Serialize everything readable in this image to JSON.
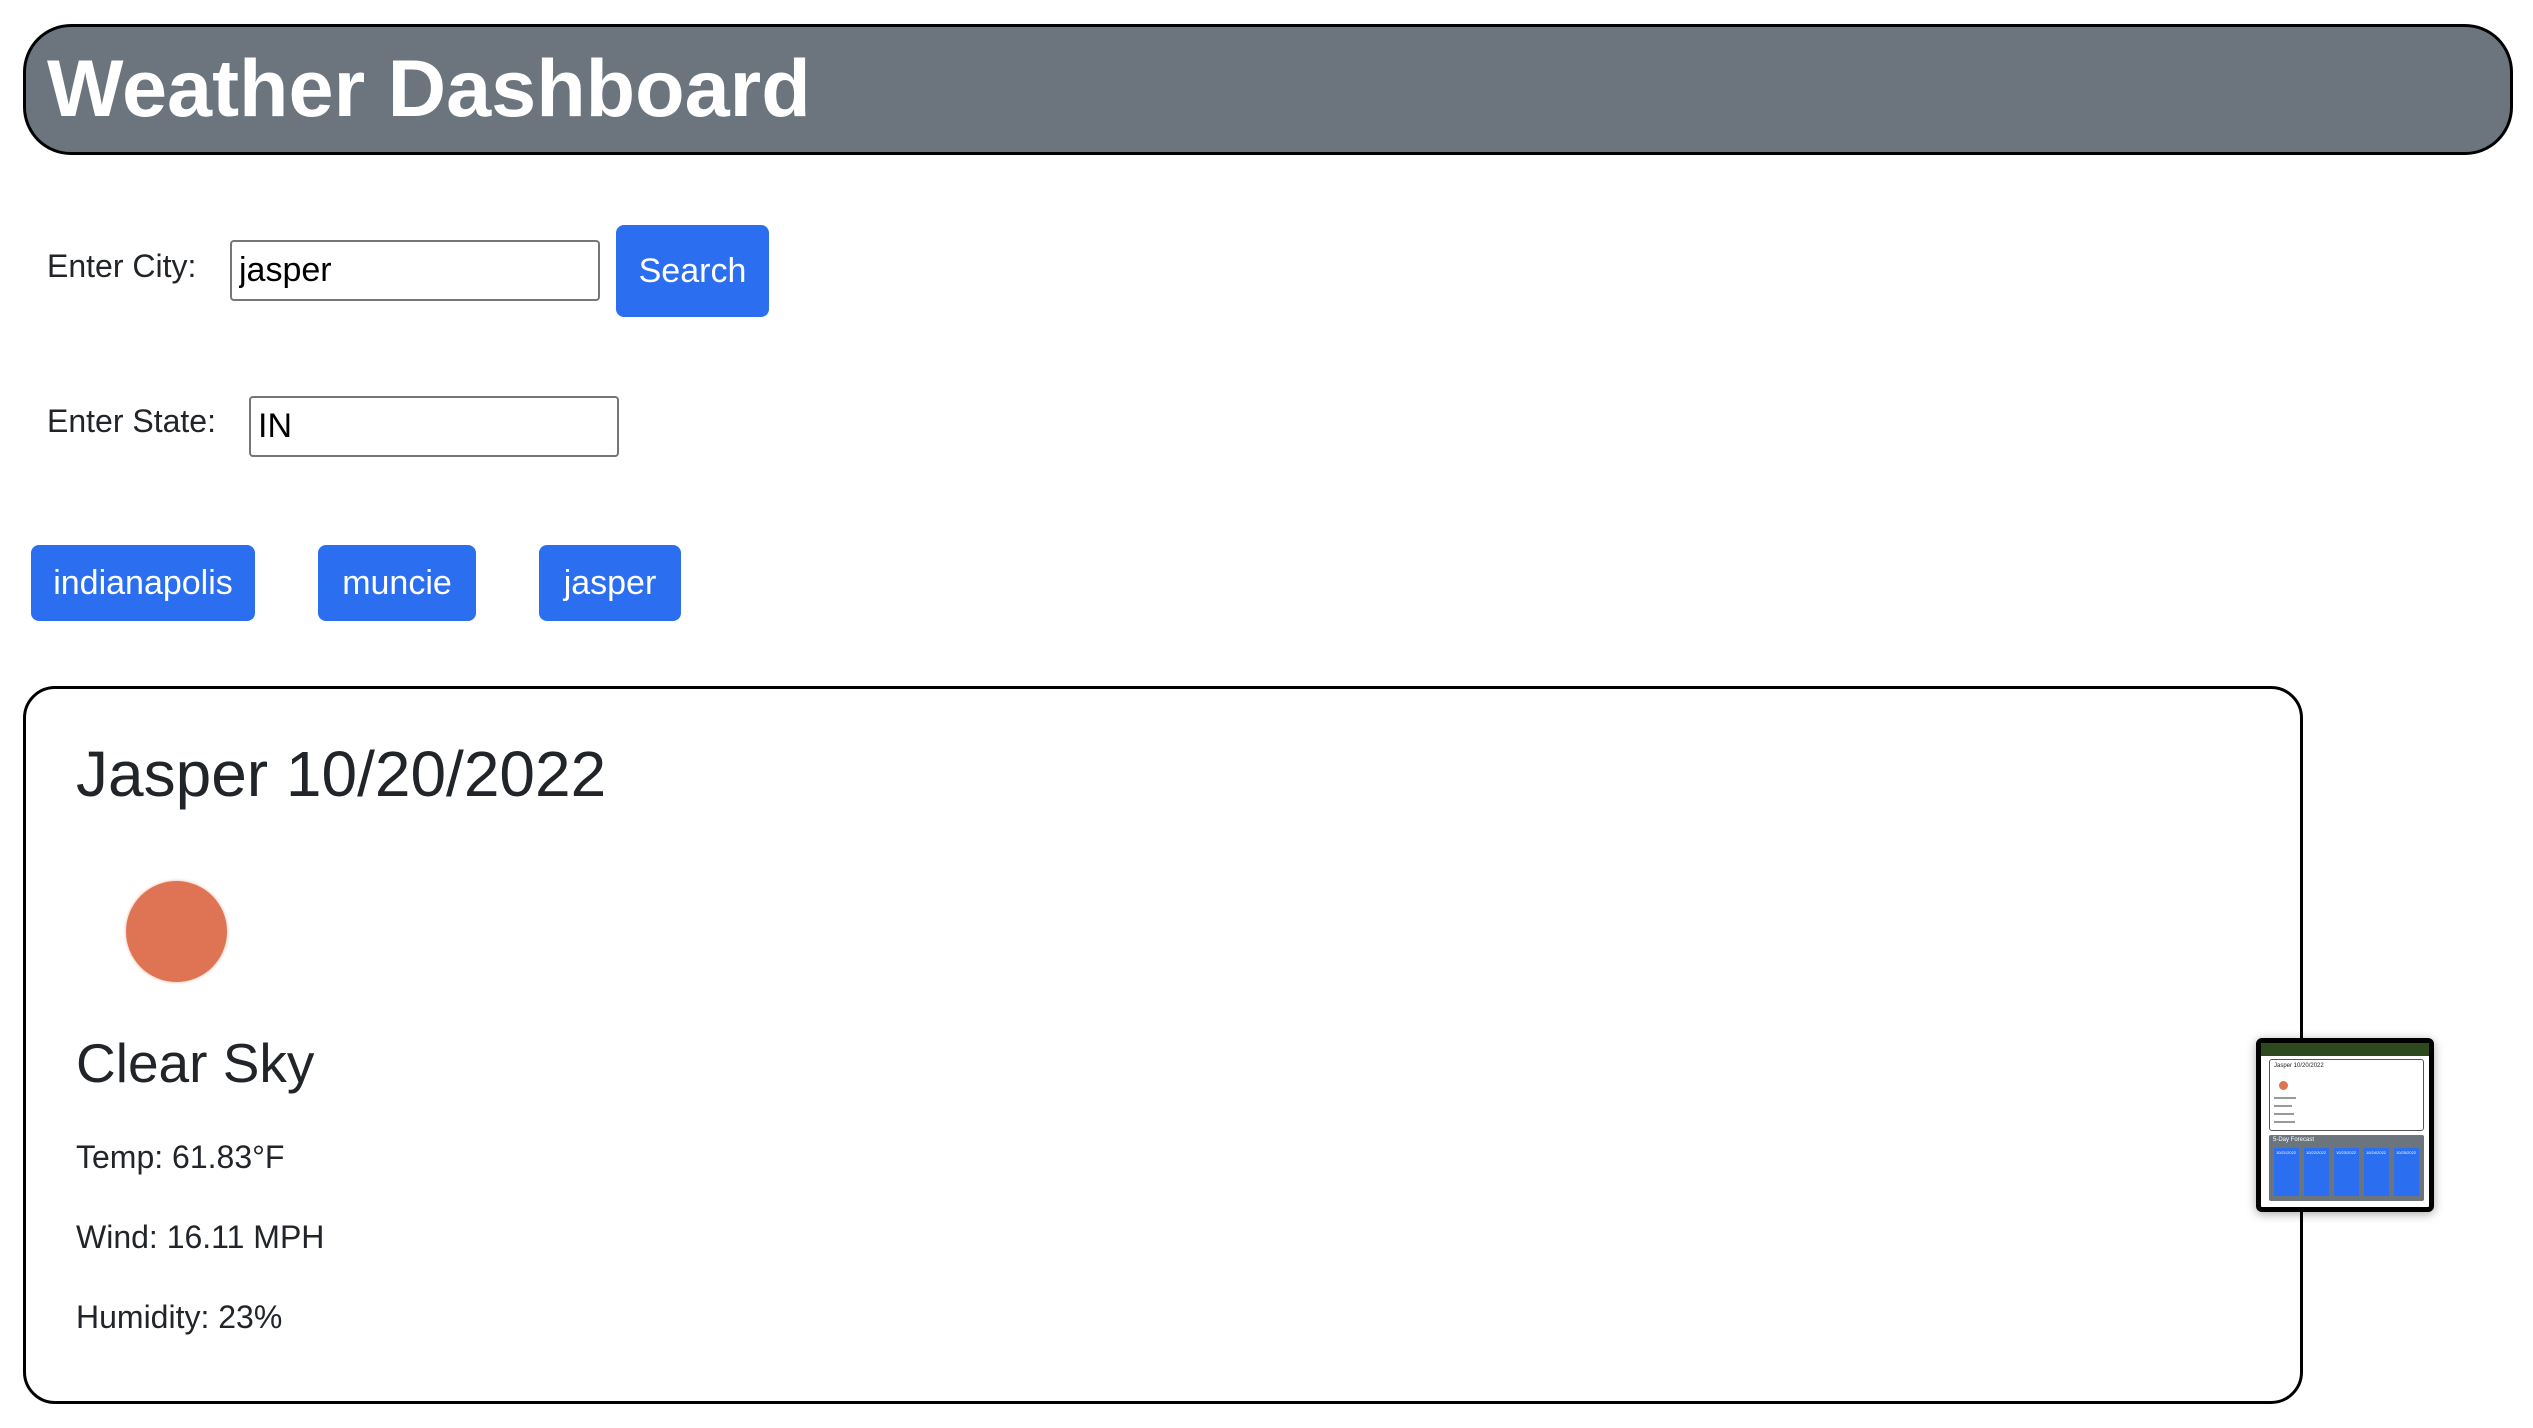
{
  "header": {
    "title": "Weather Dashboard"
  },
  "search": {
    "city_label": "Enter City:",
    "city_value": "jasper",
    "state_label": "Enter State:",
    "state_value": "IN",
    "button_label": "Search"
  },
  "history": [
    {
      "label": "indianapolis"
    },
    {
      "label": "muncie"
    },
    {
      "label": "jasper"
    }
  ],
  "current": {
    "title": "Jasper 10/20/2022",
    "icon": "clear-sky-sun-icon",
    "icon_color": "#df7454",
    "condition": "Clear Sky",
    "temp": "Temp: 61.83°F",
    "wind": "Wind: 16.11 MPH",
    "humidity": "Humidity: 23%"
  },
  "thumbnail": {
    "card_title": "Jasper 10/20/2022",
    "forecast_title": "5-Day Forecast",
    "days": [
      "10/21/2022",
      "10/22/2022",
      "10/23/2022",
      "10/24/2022",
      "10/25/2022"
    ]
  },
  "colors": {
    "header_bg": "#6c757d",
    "button_bg": "#2b6ff0",
    "text": "#212529"
  }
}
